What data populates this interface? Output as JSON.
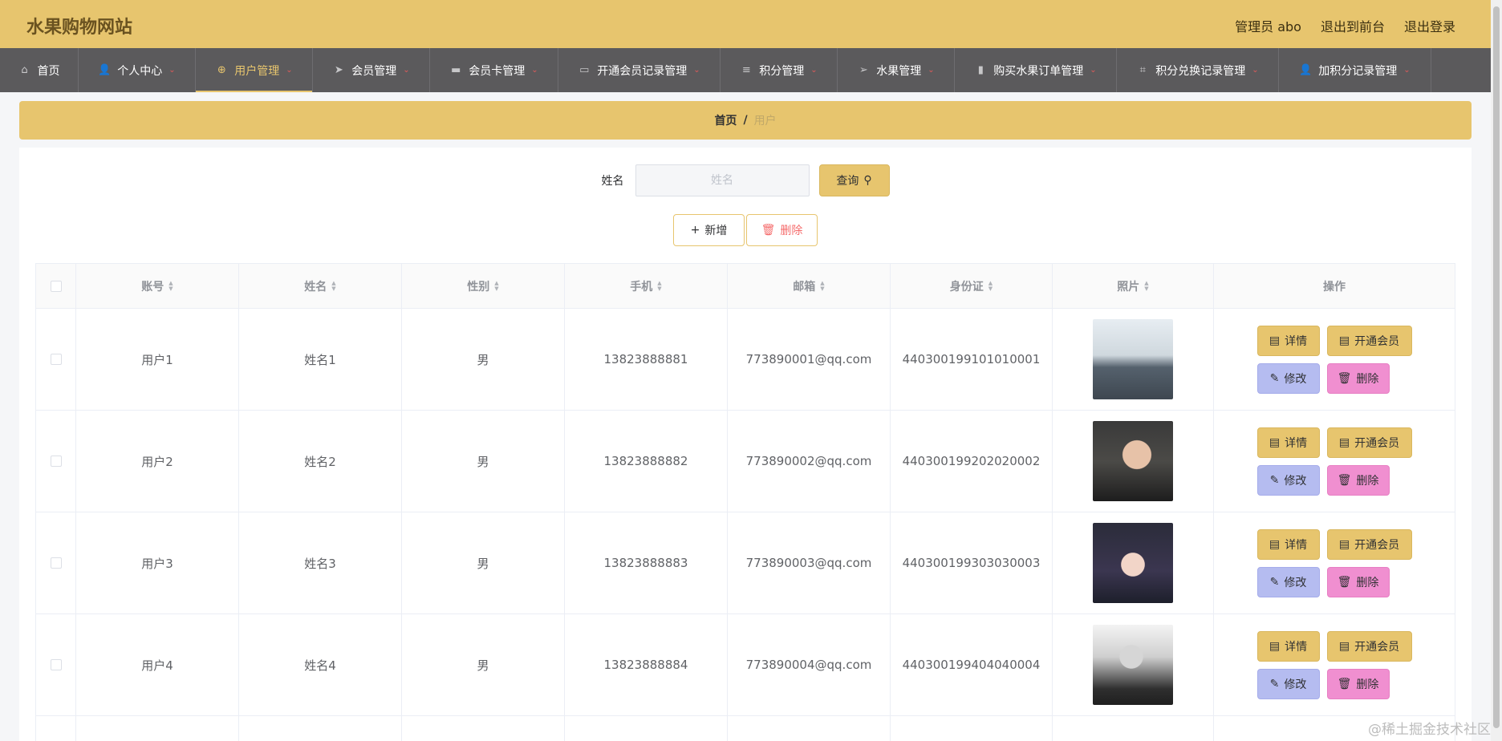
{
  "header": {
    "site_title": "水果购物网站",
    "admin_label": "管理员 abo",
    "to_front": "退出到前台",
    "logout": "退出登录"
  },
  "nav": [
    {
      "label": "首页",
      "icon": "home-icon",
      "glyph": "⌂",
      "caret": false
    },
    {
      "label": "个人中心",
      "icon": "user-icon",
      "glyph": "👤",
      "caret": true
    },
    {
      "label": "用户管理",
      "icon": "crosshair-icon",
      "glyph": "⊕",
      "caret": true,
      "active": true
    },
    {
      "label": "会员管理",
      "icon": "paper-plane-icon",
      "glyph": "➤",
      "caret": true
    },
    {
      "label": "会员卡管理",
      "icon": "monitor-icon",
      "glyph": "▬",
      "caret": true
    },
    {
      "label": "开通会员记录管理",
      "icon": "ticket-icon",
      "glyph": "▭",
      "caret": true
    },
    {
      "label": "积分管理",
      "icon": "list-icon",
      "glyph": "≡",
      "caret": true
    },
    {
      "label": "水果管理",
      "icon": "navigation-icon",
      "glyph": "➢",
      "caret": true
    },
    {
      "label": "购买水果订单管理",
      "icon": "chart-icon",
      "glyph": "▮",
      "caret": true
    },
    {
      "label": "积分兑换记录管理",
      "icon": "crop-icon",
      "glyph": "⌗",
      "caret": true
    },
    {
      "label": "加积分记录管理",
      "icon": "user-icon",
      "glyph": "👤",
      "caret": true
    }
  ],
  "breadcrumb": {
    "home": "首页",
    "separator": "/",
    "current": "用户"
  },
  "search": {
    "label": "姓名",
    "placeholder": "姓名",
    "button": "查询"
  },
  "actions": {
    "add": "新增",
    "delete": "删除"
  },
  "table": {
    "headers": [
      "账号",
      "姓名",
      "性别",
      "手机",
      "邮箱",
      "身份证",
      "照片",
      "操作"
    ],
    "rows": [
      {
        "account": "用户1",
        "name": "姓名1",
        "gender": "男",
        "phone": "13823888881",
        "email": "773890001@qq.com",
        "id_card": "440300199101010001"
      },
      {
        "account": "用户2",
        "name": "姓名2",
        "gender": "男",
        "phone": "13823888882",
        "email": "773890002@qq.com",
        "id_card": "440300199202020002"
      },
      {
        "account": "用户3",
        "name": "姓名3",
        "gender": "男",
        "phone": "13823888883",
        "email": "773890003@qq.com",
        "id_card": "440300199303030003"
      },
      {
        "account": "用户4",
        "name": "姓名4",
        "gender": "男",
        "phone": "13823888884",
        "email": "773890004@qq.com",
        "id_card": "440300199404040004"
      }
    ],
    "row_actions": {
      "detail": "详情",
      "member": "开通会员",
      "edit": "修改",
      "delete": "删除"
    }
  },
  "watermark": "@稀土掘金技术社区",
  "colors": {
    "accent": "#e7c56e",
    "nav_bg": "#5b5a5c",
    "edit_btn": "#b5bcf0",
    "delete_btn": "#f08fd0"
  }
}
